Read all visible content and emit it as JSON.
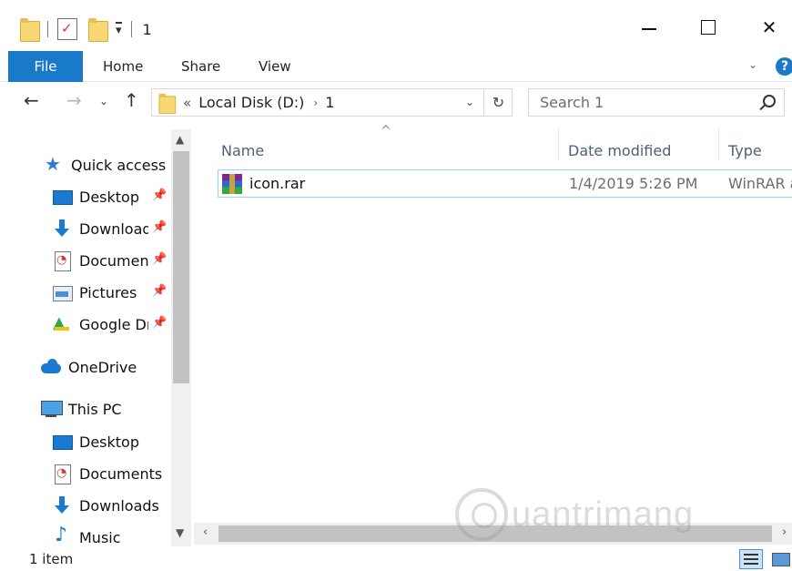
{
  "window": {
    "title": "1",
    "controls": {
      "minimize": "—",
      "maximize": "☐",
      "close": "✕"
    }
  },
  "ribbon": {
    "tabs": [
      {
        "label": "File"
      },
      {
        "label": "Home"
      },
      {
        "label": "Share"
      },
      {
        "label": "View"
      }
    ],
    "help_label": "?"
  },
  "navigation": {
    "back_glyph": "←",
    "forward_glyph": "→",
    "recent_glyph": "⌄",
    "up_glyph": "↑"
  },
  "address": {
    "overflow_glyph": "«",
    "path": [
      "Local Disk (D:)",
      "1"
    ],
    "separator_glyph": "›",
    "dropdown_glyph": "⌄",
    "refresh_glyph": "↻"
  },
  "search": {
    "placeholder": "Search 1"
  },
  "sidebar": {
    "items": [
      {
        "label": "Quick access",
        "icon": "star-icon"
      },
      {
        "label": "Desktop",
        "icon": "desktop-icon",
        "pinned": true
      },
      {
        "label": "Downloads",
        "icon": "download-icon",
        "pinned": true
      },
      {
        "label": "Documents",
        "icon": "documents-icon",
        "pinned": true
      },
      {
        "label": "Pictures",
        "icon": "pictures-icon",
        "pinned": true
      },
      {
        "label": "Google Drive",
        "icon": "google-drive-icon",
        "pinned": true
      },
      {
        "label": "OneDrive",
        "icon": "onedrive-icon"
      },
      {
        "label": "This PC",
        "icon": "this-pc-icon"
      },
      {
        "label": "Desktop",
        "icon": "desktop-icon"
      },
      {
        "label": "Documents",
        "icon": "documents-icon"
      },
      {
        "label": "Downloads",
        "icon": "download-icon"
      },
      {
        "label": "Music",
        "icon": "music-icon"
      }
    ],
    "pin_glyph": "📌"
  },
  "file_list": {
    "columns": [
      "Name",
      "Date modified",
      "Type"
    ],
    "sort_glyph": "^",
    "rows": [
      {
        "name": "icon.rar",
        "date_modified": "1/4/2019 5:26 PM",
        "type": "WinRAR archive",
        "icon": "rar-archive-icon"
      }
    ]
  },
  "status": {
    "item_count": "1 item"
  },
  "watermark": {
    "text": "uantrimang"
  },
  "colors": {
    "accent": "#1979ca",
    "selection_border": "#99d1ff",
    "column_header": "#4c607a"
  }
}
